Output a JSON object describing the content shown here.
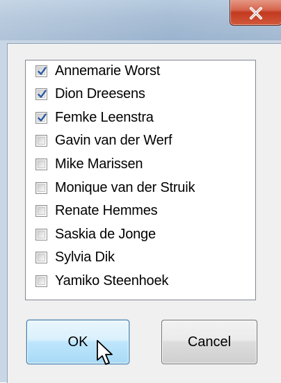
{
  "window": {
    "close_glyph": "x"
  },
  "list": {
    "items": [
      {
        "label": "Annemarie Worst",
        "checked": true
      },
      {
        "label": "Dion Dreesens",
        "checked": true
      },
      {
        "label": "Femke Leenstra",
        "checked": true
      },
      {
        "label": "Gavin van der Werf",
        "checked": false
      },
      {
        "label": "Mike Marissen",
        "checked": false
      },
      {
        "label": "Monique van der Struik",
        "checked": false
      },
      {
        "label": "Renate Hemmes",
        "checked": false
      },
      {
        "label": "Saskia de Jonge",
        "checked": false
      },
      {
        "label": "Sylvia Dik",
        "checked": false
      },
      {
        "label": "Yamiko Steenhoek",
        "checked": false
      }
    ]
  },
  "buttons": {
    "ok_label": "OK",
    "cancel_label": "Cancel"
  },
  "colors": {
    "checkmark": "#2b5aa6",
    "close_button": "#c2391f",
    "ok_button_border": "#3c7fb1"
  },
  "icons": {
    "close": "close-icon",
    "cursor": "mouse-pointer-icon",
    "check": "checkmark-icon"
  }
}
